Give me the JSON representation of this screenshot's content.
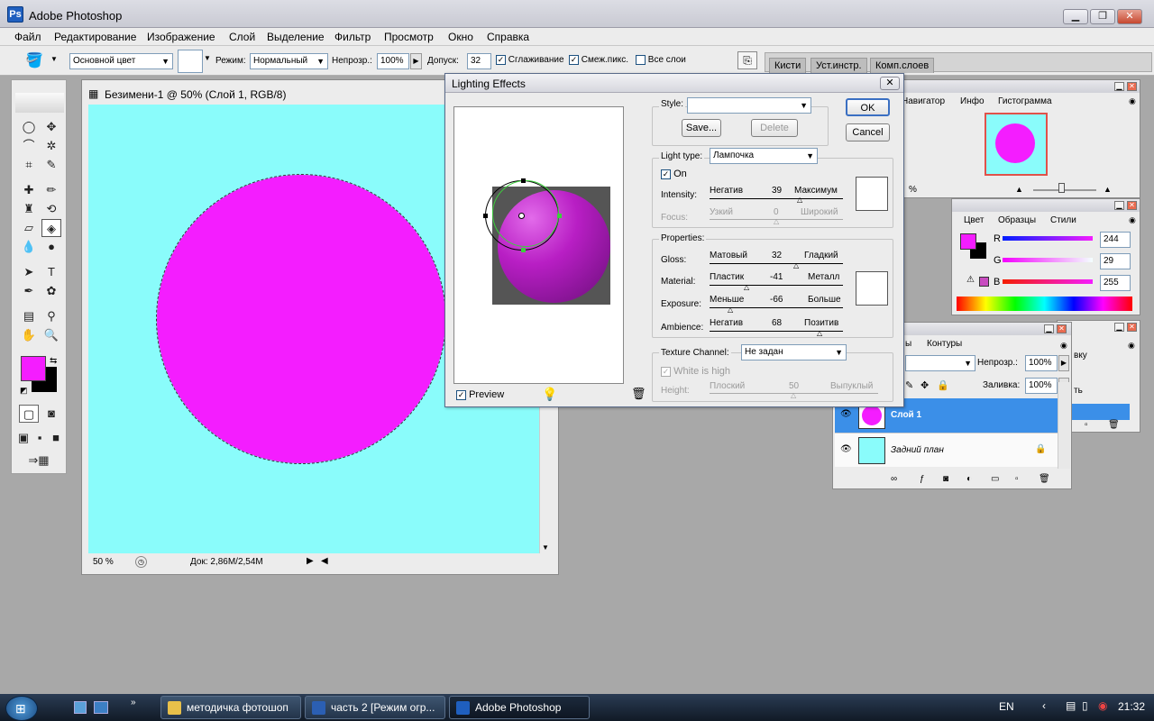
{
  "window": {
    "title": "Adobe Photoshop",
    "app_icon_letter": "Ps"
  },
  "menu": [
    "Файл",
    "Редактирование",
    "Изображение",
    "Слой",
    "Выделение",
    "Фильтр",
    "Просмотр",
    "Окно",
    "Справка"
  ],
  "options": {
    "fill_source": "Основной цвет",
    "mode_label": "Режим:",
    "mode_value": "Нормальный",
    "opacity_label": "Непрозр.:",
    "opacity_value": "100%",
    "tolerance_label": "Допуск:",
    "tolerance_value": "32",
    "antialias_label": "Сглаживание",
    "contiguous_label": "Смеж.пикс.",
    "all_layers_label": "Все слои"
  },
  "panel_well": {
    "tabs": [
      "Кисти",
      "Уст.инстр.",
      "Комп.слоев"
    ]
  },
  "document": {
    "title": "Безимени-1 @ 50% (Слой 1, RGB/8)",
    "zoom": "50 %",
    "doc_size": "Док: 2,86M/2,54M",
    "canvas_color": "#8afcfb",
    "shape_color": "#f41dff"
  },
  "dialog": {
    "title": "Lighting Effects",
    "style_label": "Style:",
    "save_label": "Save...",
    "delete_label": "Delete",
    "ok_label": "OK",
    "cancel_label": "Cancel",
    "light_type_label": "Light type:",
    "light_type_value": "Лампочка",
    "on_label": "On",
    "intensity_label": "Intensity:",
    "intensity_min": "Негатив",
    "intensity_value": "39",
    "intensity_max": "Максимум",
    "focus_label": "Focus:",
    "focus_min": "Узкий",
    "focus_value": "0",
    "focus_max": "Широкий",
    "properties_label": "Properties:",
    "gloss_label": "Gloss:",
    "gloss_min": "Матовый",
    "gloss_value": "32",
    "gloss_max": "Гладкий",
    "material_label": "Material:",
    "material_min": "Пластик",
    "material_value": "-41",
    "material_max": "Металл",
    "exposure_label": "Exposure:",
    "exposure_min": "Меньше",
    "exposure_value": "-66",
    "exposure_max": "Больше",
    "ambience_label": "Ambience:",
    "ambience_min": "Негатив",
    "ambience_value": "68",
    "ambience_max": "Позитив",
    "texture_label": "Texture Channel:",
    "texture_value": "Не задан",
    "white_high_label": "White is high",
    "height_label": "Height:",
    "height_min": "Плоский",
    "height_value": "50",
    "height_max": "Выпуклый",
    "preview_label": "Preview"
  },
  "navigator": {
    "tabs": [
      "Навигатор",
      "Инфо",
      "Гистограмма"
    ],
    "zoom": "%"
  },
  "color_panel": {
    "tabs": [
      "Цвет",
      "Образцы",
      "Стили"
    ],
    "r_label": "R",
    "r_value": "244",
    "g_label": "G",
    "g_value": "29",
    "b_label": "B",
    "b_value": "255",
    "foreground": "#f41dff"
  },
  "layers": {
    "tabs": [
      "ы",
      "Контуры"
    ],
    "opacity_label": "Непрозр.:",
    "opacity_value": "100%",
    "fill_label": "Заливка:",
    "fill_value": "100%",
    "side_text_1": "вку",
    "side_text_2": "ть",
    "items": [
      {
        "name": "Слой 1",
        "selected": true
      },
      {
        "name": "Задний план",
        "selected": false
      }
    ]
  },
  "taskbar": {
    "tasks": [
      "методичка фотошоп",
      "часть 2 [Режим огр...",
      "Adobe Photoshop"
    ],
    "lang": "EN",
    "time": "21:32"
  }
}
